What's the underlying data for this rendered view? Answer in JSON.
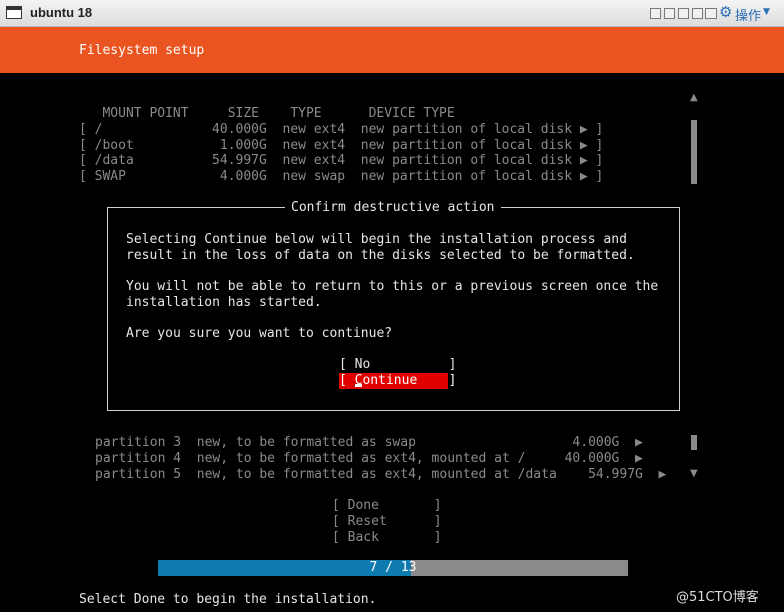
{
  "window": {
    "title": "ubuntu 18",
    "menu_label": "操作"
  },
  "header": {
    "title": "Filesystem setup"
  },
  "table": {
    "header": "   MOUNT POINT     SIZE    TYPE      DEVICE TYPE",
    "rows": [
      "[ /              40.000G  new ext4  new partition of local disk ▶ ]",
      "[ /boot           1.000G  new ext4  new partition of local disk ▶ ]",
      "[ /data          54.997G  new ext4  new partition of local disk ▶ ]",
      "[ SWAP            4.000G  new swap  new partition of local disk ▶ ]"
    ]
  },
  "dialog": {
    "title": "Confirm destructive action",
    "lines": [
      "Selecting Continue below will begin the installation process and",
      "result in the loss of data on the disks selected to be formatted.",
      "You will not be able to return to this or a previous screen once the",
      "installation has started.",
      "Are you sure you want to continue?"
    ],
    "no_label": "[ No          ]",
    "continue_label": "[ Continue    ]"
  },
  "partitions": [
    "partition 3  new, to be formatted as swap                    4.000G  ▶",
    "partition 4  new, to be formatted as ext4, mounted at /     40.000G  ▶",
    "partition 5  new, to be formatted as ext4, mounted at /data    54.997G  ▶"
  ],
  "buttons": {
    "done": "[ Done       ]",
    "reset": "[ Reset      ]",
    "back": "[ Back       ]"
  },
  "progress": {
    "label": "7 / 13",
    "current": 7,
    "total": 13
  },
  "footer": "Select Done to begin the installation.",
  "watermark": "@51CTO博客"
}
